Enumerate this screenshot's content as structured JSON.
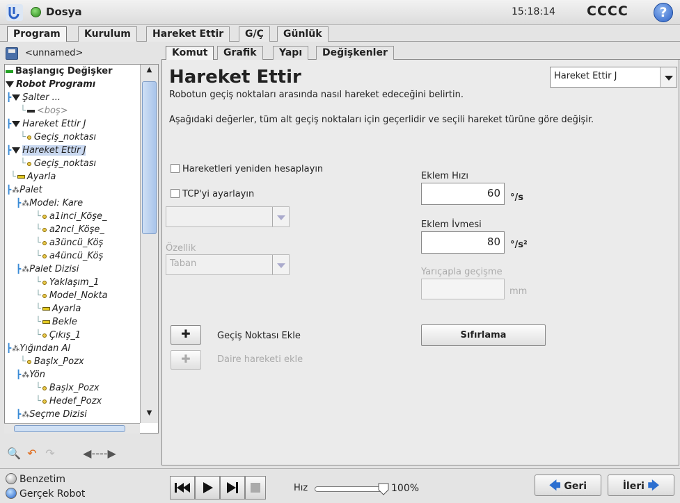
{
  "app": {
    "title": "Dosya",
    "clock": "15:18:14",
    "robot_name": "CCCC",
    "help": "?"
  },
  "top_tabs": [
    "Program",
    "Kurulum",
    "Hareket Ettir",
    "G/Ç",
    "Günlük"
  ],
  "file": {
    "name": "<unnamed>"
  },
  "tree": {
    "rows": [
      {
        "text": "Başlangıç Değişker",
        "glyph": "green-bar",
        "style": "bold"
      },
      {
        "text": "Robot Programı",
        "glyph": "triangle",
        "style": "bold-italic"
      },
      {
        "text": "Şalter ...",
        "glyph": "triangle",
        "style": "italic"
      },
      {
        "text": "<boş>",
        "glyph": "bar",
        "style": "italic-grey"
      },
      {
        "text": "Hareket Ettir J",
        "glyph": "triangle",
        "style": "italic"
      },
      {
        "text": "Geçiş_noktası",
        "glyph": "waypoint",
        "style": "italic"
      },
      {
        "text": "Hareket Ettir J",
        "glyph": "triangle",
        "style": "italic-selected"
      },
      {
        "text": "Geçiş_noktası",
        "glyph": "waypoint",
        "style": "italic"
      },
      {
        "text": "Ayarla",
        "glyph": "yellow-bar",
        "style": "italic"
      },
      {
        "text": "Palet",
        "glyph": "pallet",
        "style": "italic"
      },
      {
        "text": "Model: Kare",
        "glyph": "pallet",
        "style": "italic"
      },
      {
        "text": "a1inci_Köşe_",
        "glyph": "waypoint",
        "style": "italic"
      },
      {
        "text": "a2nci_Köşe_",
        "glyph": "waypoint",
        "style": "italic"
      },
      {
        "text": "a3üncü_Köş",
        "glyph": "waypoint",
        "style": "italic"
      },
      {
        "text": "a4üncü_Köş",
        "glyph": "waypoint",
        "style": "italic"
      },
      {
        "text": "Palet Dizisi",
        "glyph": "pallet",
        "style": "italic"
      },
      {
        "text": "Yaklaşım_1",
        "glyph": "waypoint",
        "style": "italic"
      },
      {
        "text": "Model_Nokta",
        "glyph": "waypoint",
        "style": "italic"
      },
      {
        "text": "Ayarla",
        "glyph": "yellow-bar",
        "style": "italic"
      },
      {
        "text": "Bekle",
        "glyph": "yellow-bar",
        "style": "italic"
      },
      {
        "text": "Çıkış_1",
        "glyph": "waypoint",
        "style": "italic"
      },
      {
        "text": "Yığından Al",
        "glyph": "pallet",
        "style": "italic"
      },
      {
        "text": "Başlx_Pozx",
        "glyph": "waypoint",
        "style": "italic"
      },
      {
        "text": "Yön",
        "glyph": "pallet",
        "style": "italic"
      },
      {
        "text": "Başlx_Pozx",
        "glyph": "waypoint",
        "style": "italic"
      },
      {
        "text": "Hedef_Pozx",
        "glyph": "waypoint",
        "style": "italic"
      },
      {
        "text": "Seçme Dizisi",
        "glyph": "pallet",
        "style": "italic"
      }
    ]
  },
  "sub_tabs": [
    "Komut",
    "Grafik",
    "Yapı",
    "Değişkenler"
  ],
  "main": {
    "title": "Hareket Ettir",
    "move_type": "Hareket Ettir J",
    "desc1": "Robotun geçiş noktaları arasında nasıl hareket edeceğini belirtin.",
    "desc2": "Aşağıdaki değerler, tüm alt geçiş noktaları için geçerlidir ve seçili hareket türüne göre değişir.",
    "recalc_label": "Hareketleri yeniden hesaplayın",
    "set_tcp_label": "TCP'yi ayarlayın",
    "tcp_select": "",
    "feature_label": "Özellik",
    "feature_value": "Taban",
    "joint_speed_label": "Eklem Hızı",
    "joint_speed_value": "60",
    "joint_speed_unit": "°/s",
    "joint_accel_label": "Eklem İvmesi",
    "joint_accel_value": "80",
    "joint_accel_unit": "°/s²",
    "blend_label": "Yarıçapla geçişme",
    "blend_value": "",
    "blend_unit": "mm",
    "add_waypoint_label": "Geçiş Noktası Ekle",
    "add_circle_label": "Daire hareketi ekle",
    "reset_label": "Sıfırlama"
  },
  "bottom": {
    "sim_label": "Benzetim",
    "real_label": "Gerçek Robot",
    "speed_label": "Hız",
    "speed_value": "100%",
    "speed_fraction": 1.0,
    "back_label": "Geri",
    "next_label": "İleri"
  },
  "colors": {
    "accent_blue": "#2c6fd0",
    "running_green": "#2b8a1a",
    "selection": "#c9d8f0"
  }
}
